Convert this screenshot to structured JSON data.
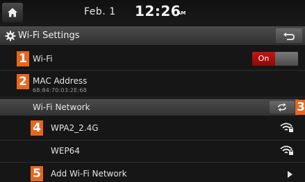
{
  "status": {
    "date": "Feb.  1",
    "time": "12:26",
    "ampm": "AM"
  },
  "header": {
    "title": "Wi-Fi Settings"
  },
  "rows": {
    "wifi": {
      "label": "Wi-Fi",
      "toggle_label": "On"
    },
    "mac": {
      "label": "MAC Address",
      "value": "68:84:70:03:2E:68"
    },
    "network_header": {
      "label": "Wi-Fi Network"
    },
    "networks": [
      {
        "ssid": "WPA2_2.4G",
        "icon": "wifi-lock-icon"
      },
      {
        "ssid": "WEP64",
        "icon": "wifi-lock-icon"
      }
    ],
    "add": {
      "label": "Add Wi-Fi Network"
    }
  },
  "callouts": [
    "1",
    "2",
    "3",
    "4",
    "5"
  ],
  "colors": {
    "callout": "#e8651c",
    "toggle_on": "#c81414",
    "background": "#161616"
  }
}
